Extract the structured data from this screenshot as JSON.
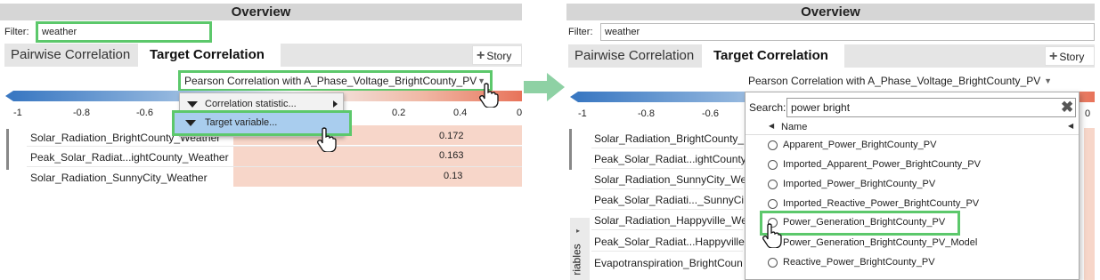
{
  "left": {
    "overview_title": "Overview",
    "filter_label": "Filter:",
    "filter_value": "weather",
    "tabs": [
      "Pairwise Correlation",
      "Target Correlation"
    ],
    "story_label": "Story",
    "dropdown_label": "Pearson Correlation with A_Phase_Voltage_BrightCounty_PV",
    "axis_ticks": [
      "-1",
      "-0.8",
      "-0.6",
      "0.2",
      "0.4",
      "0"
    ],
    "menu_items": [
      "Correlation statistic...",
      "Target variable..."
    ],
    "rows": [
      {
        "label": "Solar_Radiation_BrightCounty_Weather",
        "value": 0.172,
        "display": "0.172"
      },
      {
        "label": "Peak_Solar_Radiat...ightCounty_Weather",
        "value": 0.163,
        "display": "0.163"
      },
      {
        "label": "Solar_Radiation_SunnyCity_Weather",
        "value": 0.13,
        "display": "0.13"
      }
    ]
  },
  "right": {
    "overview_title": "Overview",
    "filter_label": "Filter:",
    "filter_value": "weather",
    "tabs": [
      "Pairwise Correlation",
      "Target Correlation"
    ],
    "story_label": "Story",
    "dropdown_label": "Pearson Correlation with A_Phase_Voltage_BrightCounty_PV",
    "axis_ticks": [
      "-1",
      "-0.8",
      "-0.6",
      "0"
    ],
    "search_label": "Search:",
    "search_value": "power bright",
    "column_header": "Name",
    "side_label": "riables",
    "rows": [
      "Solar_Radiation_BrightCounty_",
      "Peak_Solar_Radiat...ightCounty",
      "Solar_Radiation_SunnyCity_We",
      "Peak_Solar_Radiati..._SunnyCi",
      "Solar_Radiation_Happyville_We",
      "Peak_Solar_Radiat...Happyville",
      "Evapotranspiration_BrightCoun"
    ],
    "options": [
      "Apparent_Power_BrightCounty_PV",
      "Imported_Apparent_Power_BrightCounty_PV",
      "Imported_Power_BrightCounty_PV",
      "Imported_Reactive_Power_BrightCounty_PV",
      "Power_Generation_BrightCounty_PV",
      "Power_Generation_BrightCounty_PV_Model",
      "Reactive_Power_BrightCounty_PV"
    ]
  },
  "colors": {
    "highlight": "#5cc86b",
    "arrow": "#8ed1a4",
    "bar_fill": "#f7d6c9",
    "menu_selected": "#a9cdee"
  }
}
